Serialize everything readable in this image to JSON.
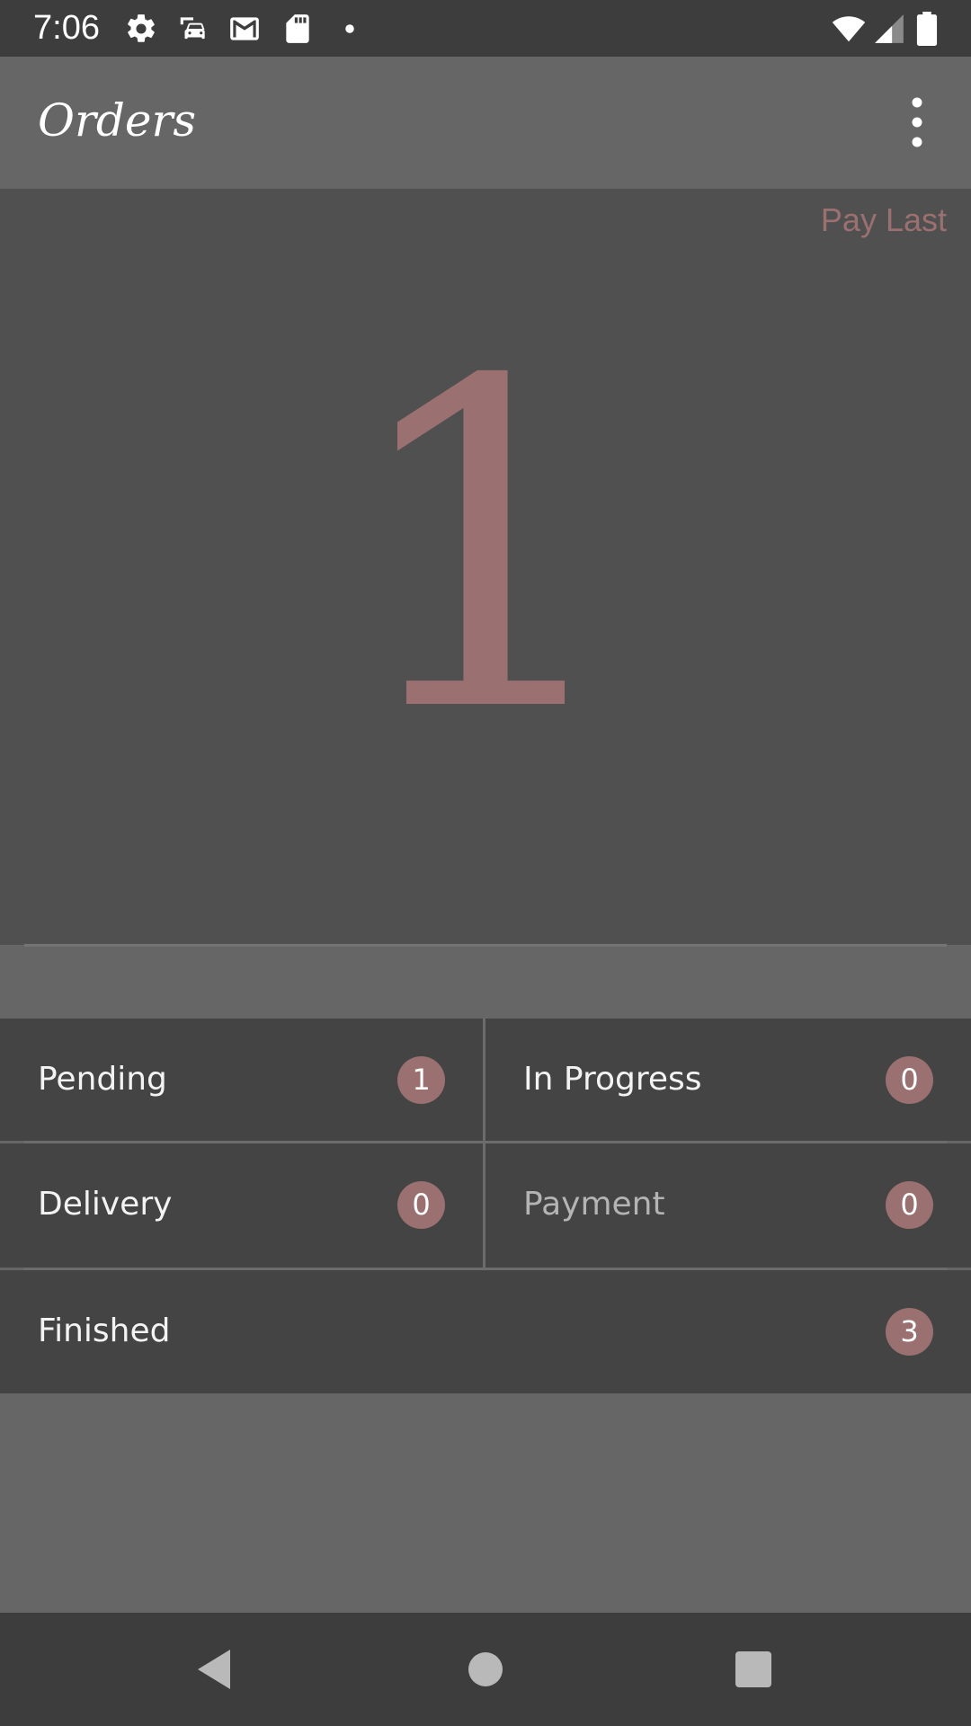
{
  "status_bar": {
    "time": "7:06",
    "left_icons": [
      "settings-icon",
      "car-sync-icon",
      "gmail-icon",
      "sd-card-icon",
      "notification-dot-icon"
    ],
    "right_icons": [
      "wifi-icon",
      "cell-signal-icon",
      "battery-icon"
    ]
  },
  "app_bar": {
    "title": "Orders",
    "menu_icon": "more-vert-icon"
  },
  "hero": {
    "action_label": "Pay Last",
    "count": "1"
  },
  "order_status": [
    {
      "label": "Pending",
      "count": "1"
    },
    {
      "label": "In Progress",
      "count": "0"
    },
    {
      "label": "Delivery",
      "count": "0"
    },
    {
      "label": "Payment",
      "count": "0"
    },
    {
      "label": "Finished",
      "count": "3"
    }
  ],
  "nav_bar": {
    "icons": [
      "back-icon",
      "home-icon",
      "recents-icon"
    ]
  },
  "colors": {
    "accent": "#9b7070",
    "status_bar": "#3d3d3d",
    "app_bar": "#666666",
    "hero_bg": "#505050",
    "cell_bg": "#444444",
    "muted_text": "#b4b4b4"
  }
}
